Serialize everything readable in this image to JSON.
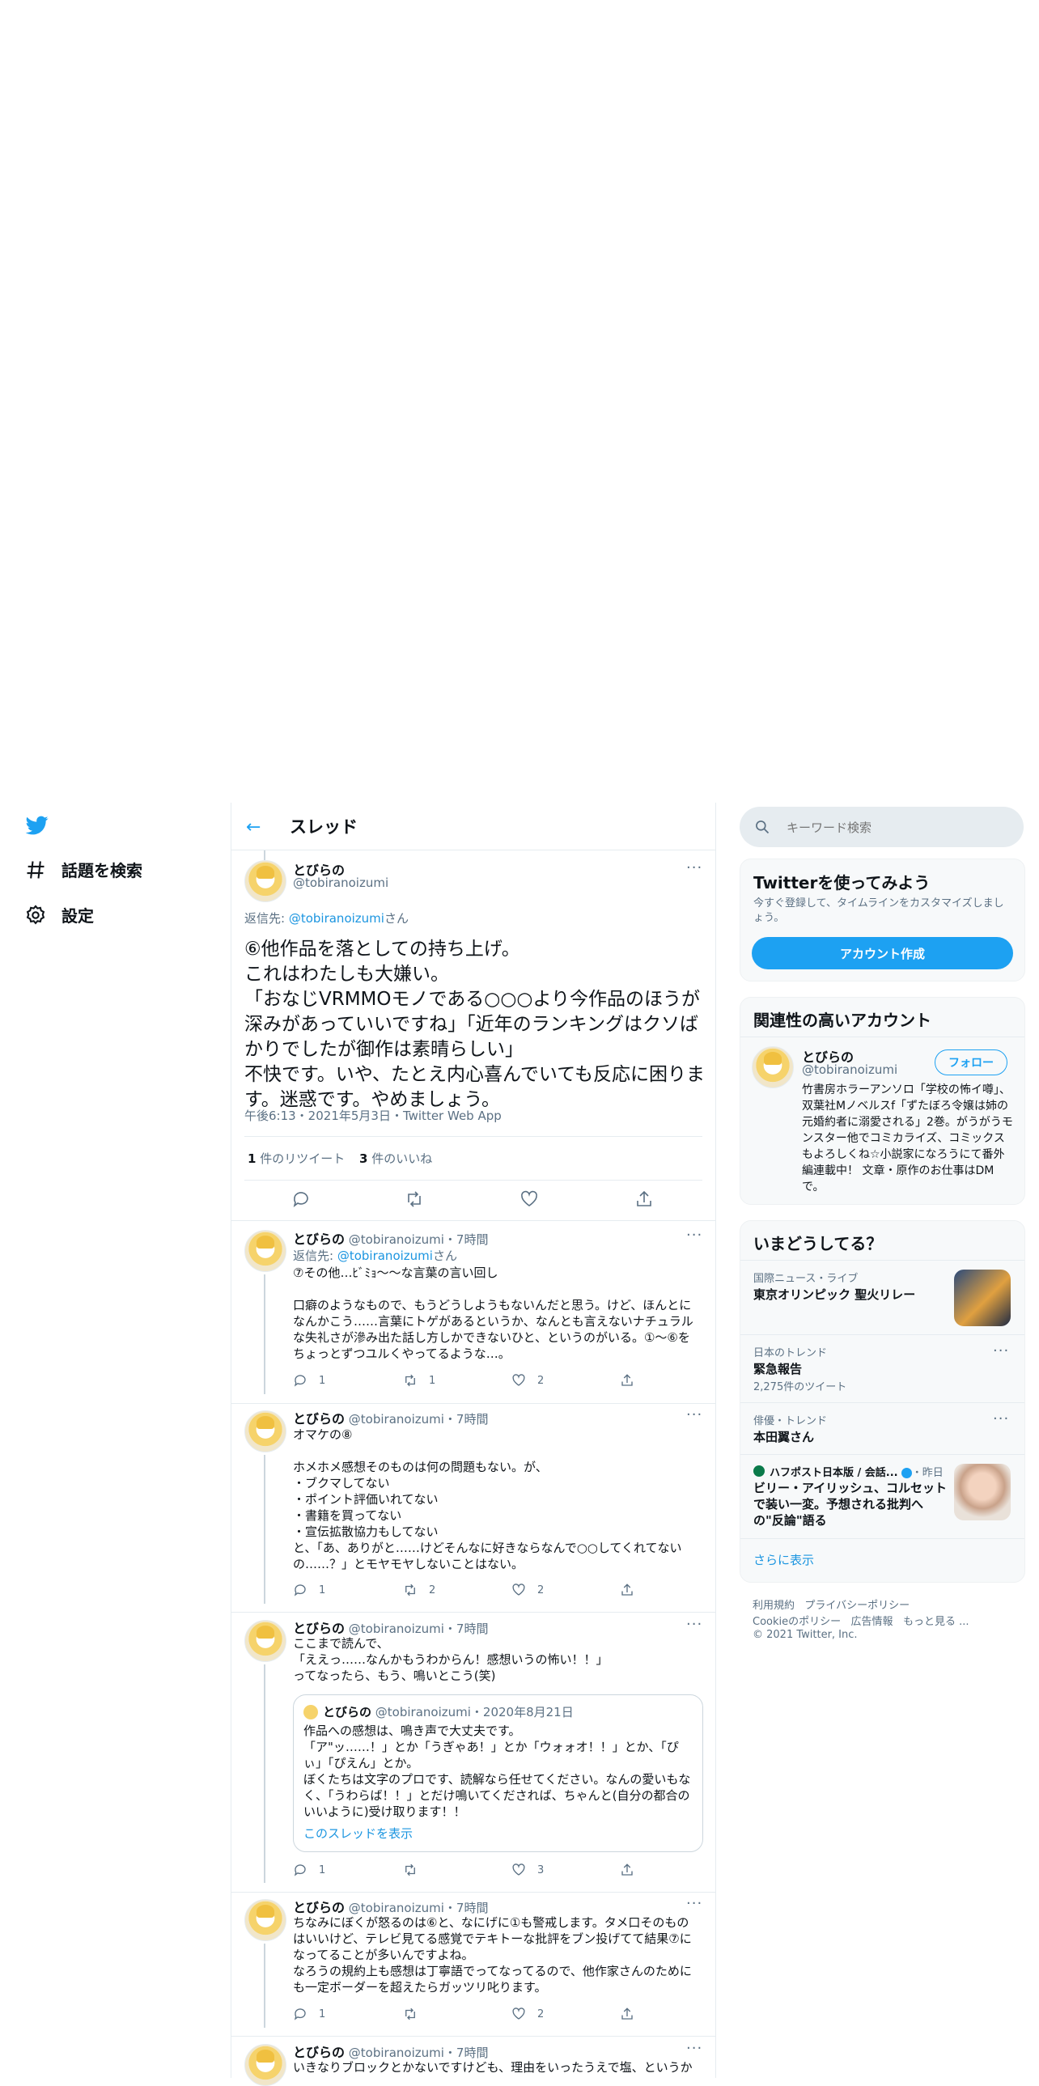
{
  "nav": {
    "explore_label": "話題を検索",
    "settings_label": "設定"
  },
  "header": {
    "title": "スレッド"
  },
  "main_tweet": {
    "name": "とびらの",
    "handle": "@tobiranoizumi",
    "reply_prefix": "返信先: ",
    "reply_handle": "@tobiranoizumi",
    "reply_suffix": "さん",
    "body": "⑥他作品を落としての持ち上げ。\nこれはわたしも大嫌い。\n「おなじVRMMOモノである○○○より今作品のほうが深みがあっていいですね」「近年のランキングはクソばかりでしたが御作は素晴らしい」\n不快です。いや、たとえ内心喜んでいても反応に困ります。迷惑です。やめましょう。",
    "timestamp": "午後6:13・2021年5月3日・Twitter Web App",
    "retweet_count": "1",
    "retweet_label": "件のリツイート",
    "like_count": "3",
    "like_label": "件のいいね"
  },
  "replies": [
    {
      "name": "とびらの",
      "handle": "@tobiranoizumi",
      "time": "・7時間",
      "reply_prefix": "返信先: ",
      "reply_handle": "@tobiranoizumi",
      "reply_suffix": "さん",
      "text": "⑦その他…ﾋﾞﾐｮ〜〜な言葉の言い回し\n\n口癖のようなもので、もうどうしようもないんだと思う。けど、ほんとになんかこう……言葉にトゲがあるというか、なんとも言えないナチュラルな失礼さが滲み出た話し方しかできないひと、というのがいる。①～⑥をちょっとずつユルくやってるような…。",
      "replies": "1",
      "retweets": "1",
      "likes": "2"
    },
    {
      "name": "とびらの",
      "handle": "@tobiranoizumi",
      "time": "・7時間",
      "text": "オマケの⑧\n\nホメホメ感想そのものは何の問題もない。が、\n・ブクマしてない\n・ポイント評価いれてない\n・書籍を買ってない\n・宣伝拡散協力もしてない\nと、「あ、ありがと……けどそんなに好きならなんで○○してくれてないの……？」とモヤモヤしないことはない。",
      "replies": "1",
      "retweets": "2",
      "likes": "2"
    },
    {
      "name": "とびらの",
      "handle": "@tobiranoizumi",
      "time": "・7時間",
      "text": "ここまで読んで、\n「ええっ……なんかもうわからん！感想いうの怖い！！」\nってなったら、もう、鳴いとこう(笑)",
      "quote": {
        "name": "とびらの",
        "handle": "@tobiranoizumi",
        "date": "・2020年8月21日",
        "text": "作品への感想は、鳴き声で大丈夫です。\n「ア\"ッ……！」とか「うぎゃあ！」とか「ウォォオ！！」とか、「ぴぃ」「ぴえん」とか。\nぼくたちは文字のプロです、読解なら任せてください。なんの愛いもなく、「うわらば！！」とだけ鳴いてくだされば、ちゃんと(自分の都合のいいように)受け取ります！！",
        "show_thread": "このスレッドを表示"
      },
      "replies": "1",
      "retweets": "",
      "likes": "3"
    },
    {
      "name": "とびらの",
      "handle": "@tobiranoizumi",
      "time": "・7時間",
      "text": "ちなみにぼくが怒るのは⑥と、なにげに①も警戒します。タメ口そのものはいいけど、テレビ見てる感覚でテキトーな批評をブン投げてて結果⑦になってることが多いんですよね。\nなろうの規約上も感想は丁寧語でってなってるので、他作家さんのためにも一定ボーダーを超えたらガッツリ叱ります。",
      "replies": "1",
      "retweets": "",
      "likes": "2"
    },
    {
      "name": "とびらの",
      "handle": "@tobiranoizumi",
      "time": "・7時間",
      "text": "いきなりブロックとかないですけども、理由をいったうえで塩、というか"
    }
  ],
  "search": {
    "placeholder": "キーワード検索"
  },
  "signup": {
    "title": "Twitterを使ってみよう",
    "desc": "今すぐ登録して、タイムラインをカスタマイズしましょう。",
    "button": "アカウント作成"
  },
  "related": {
    "title": "関連性の高いアカウント",
    "name": "とびらの",
    "handle": "@tobiranoizumi",
    "follow": "フォロー",
    "bio": "竹書房ホラーアンソロ「学校の怖イ噂」、双葉社Mノベルスf「ずたぼろ令嬢は姉の元婚約者に溺愛される」2巻。がうがうモンスター他でコミカライズ、コミックスもよろしくね☆小説家になろうにて番外編連載中！ 文章・原作のお仕事はDMで。"
  },
  "trends": {
    "title": "いまどうしてる？",
    "items": [
      {
        "category": "国際ニュース・ライブ",
        "title": "東京オリンピック 聖火リレー",
        "sub": ""
      },
      {
        "category": "日本のトレンド",
        "title": "緊急報告",
        "sub": "2,275件のツイート"
      },
      {
        "category": "俳優・トレンド",
        "title": "本田翼さん",
        "sub": ""
      },
      {
        "category": "ハフポスト日本版 / 会話...",
        "time": "・昨日",
        "title": "ビリー・アイリッシュ、コルセットで装い一変。予想される批判への\"反論\"語る",
        "sub": ""
      }
    ],
    "show_more": "さらに表示"
  },
  "footer": {
    "terms": "利用規約",
    "privacy": "プライバシーポリシー",
    "cookie": "Cookieのポリシー",
    "ads": "広告情報",
    "more": "もっと見る ...",
    "copyright": "© 2021 Twitter, Inc."
  },
  "colors": {
    "accent": "#1da1f2",
    "link": "#1b95e0",
    "secondary_text": "#5b7083",
    "border": "#e6ecf0"
  }
}
